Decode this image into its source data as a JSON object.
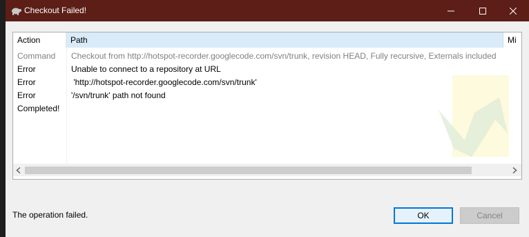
{
  "window": {
    "title": "Checkout Failed!",
    "titlebar_color": "#5c1e16",
    "app_icon": "tortoise-icon",
    "controls": [
      "minimize-icon",
      "maximize-icon",
      "close-icon"
    ]
  },
  "list": {
    "columns": [
      "Action",
      "Path",
      "Mi"
    ],
    "rows": [
      {
        "action": "Command",
        "path": "Checkout from http://hotspot-recorder.googlecode.com/svn/trunk, revision HEAD, Fully recursive, Externals included"
      },
      {
        "action": "Error",
        "path": "Unable to connect to a repository at URL"
      },
      {
        "action": "Error",
        "path": " 'http://hotspot-recorder.googlecode.com/svn/trunk'"
      },
      {
        "action": "Error",
        "path": "'/svn/trunk' path not found"
      },
      {
        "action": "Completed!",
        "path": ""
      }
    ],
    "selected_column_color": "#d9ebf9"
  },
  "status": {
    "message": "The operation failed."
  },
  "buttons": {
    "ok": "OK",
    "cancel": "Cancel"
  }
}
